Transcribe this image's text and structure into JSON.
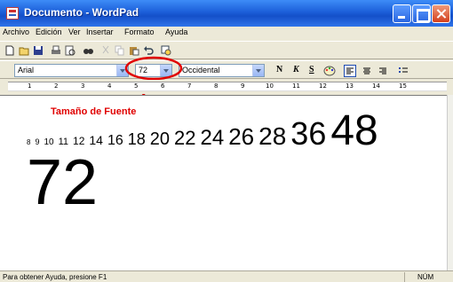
{
  "window": {
    "title": "Documento - WordPad"
  },
  "menu": [
    "Archivo",
    "Edición",
    "Ver",
    "Insertar",
    "Formato",
    "Ayuda"
  ],
  "toolbar": {
    "icons": [
      "new-document-icon",
      "open-folder-icon",
      "save-icon",
      "print-icon",
      "print-preview-icon",
      "find-icon",
      "cut-icon",
      "copy-icon",
      "paste-icon",
      "undo-icon",
      "date-time-icon"
    ]
  },
  "format_bar": {
    "font": "Arial",
    "size": "72",
    "script": "Occidental",
    "bold": "N",
    "italic": "K",
    "underline": "S"
  },
  "ruler": {
    "labels": [
      "1",
      "2",
      "3",
      "4",
      "5",
      "6",
      "7",
      "8",
      "9",
      "10",
      "11",
      "12",
      "13",
      "14",
      "15"
    ]
  },
  "annotation": {
    "label": "Tamaño de Fuente",
    "color": "#e00000"
  },
  "document": {
    "sizes": [
      "8",
      "9",
      "10",
      "11",
      "12",
      "14",
      "16",
      "18",
      "20",
      "22",
      "24",
      "26",
      "28",
      "36",
      "48"
    ],
    "big": "72"
  },
  "status": {
    "help": "Para obtener Ayuda, presione F1",
    "num": "NÚM"
  }
}
